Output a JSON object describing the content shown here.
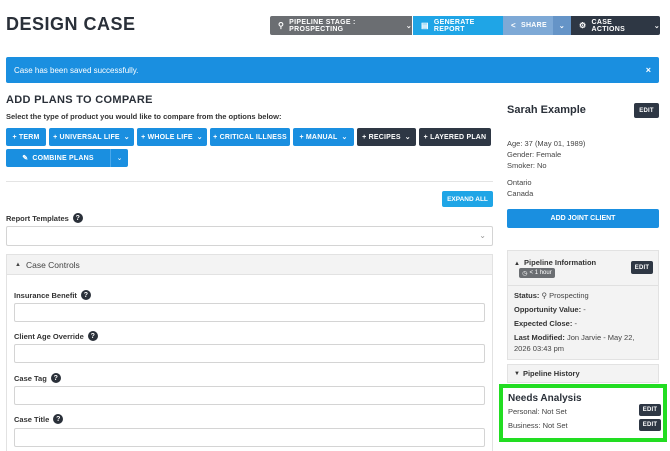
{
  "header": {
    "title": "DESIGN CASE",
    "pipeline_label": "PIPELINE STAGE : PROSPECTING",
    "generate_label": "GENERATE REPORT",
    "share_label": "SHARE",
    "case_actions_label": "CASE ACTIONS"
  },
  "alert": {
    "message": "Case has been saved successfully.",
    "close": "×"
  },
  "plans": {
    "title": "ADD PLANS TO COMPARE",
    "instruction": "Select the type of product you would like to compare from the options below:",
    "buttons": {
      "term": "+ TERM",
      "universal_life": "+ UNIVERSAL LIFE",
      "whole_life": "+ WHOLE LIFE",
      "critical_illness": "+ CRITICAL ILLNESS",
      "manual": "+ MANUAL",
      "recipes": "+ RECIPES",
      "layered_plan": "+ LAYERED PLAN",
      "combine_plans": "COMBINE PLANS"
    },
    "expand_all": "EXPAND ALL"
  },
  "report_templates": {
    "label": "Report Templates"
  },
  "case_controls": {
    "title": "Case Controls",
    "fields": {
      "insurance_benefit": "Insurance Benefit",
      "client_age_override": "Client Age Override",
      "case_tag": "Case Tag",
      "case_title": "Case Title"
    }
  },
  "client": {
    "name": "Sarah Example",
    "edit": "EDIT",
    "age": "Age: 37 (May 01, 1989)",
    "gender": "Gender: Female",
    "smoker": "Smoker: No",
    "province": "Ontario",
    "country": "Canada",
    "add_joint": "ADD JOINT CLIENT"
  },
  "pipeline_info": {
    "title": "Pipeline Information",
    "badge": "< 1 hour",
    "edit": "EDIT",
    "status_label": "Status:",
    "status_value": "Prospecting",
    "opportunity_label": "Opportunity Value:",
    "opportunity_value": "-",
    "expected_close_label": "Expected Close:",
    "expected_close_value": "-",
    "last_modified_label": "Last Modified:",
    "last_modified_value_1": "Jon Jarvie - May 22,",
    "last_modified_value_2": "2026 03:43 pm"
  },
  "pipeline_history": {
    "title": "Pipeline History"
  },
  "needs_analysis": {
    "title": "Needs Analysis",
    "personal": "Personal: Not Set",
    "business": "Business: Not Set",
    "edit": "EDIT"
  },
  "colors": {
    "primary": "#1a8fe0",
    "dark": "#2e3744",
    "grey": "#6b6e72",
    "highlight": "#22dd22"
  }
}
